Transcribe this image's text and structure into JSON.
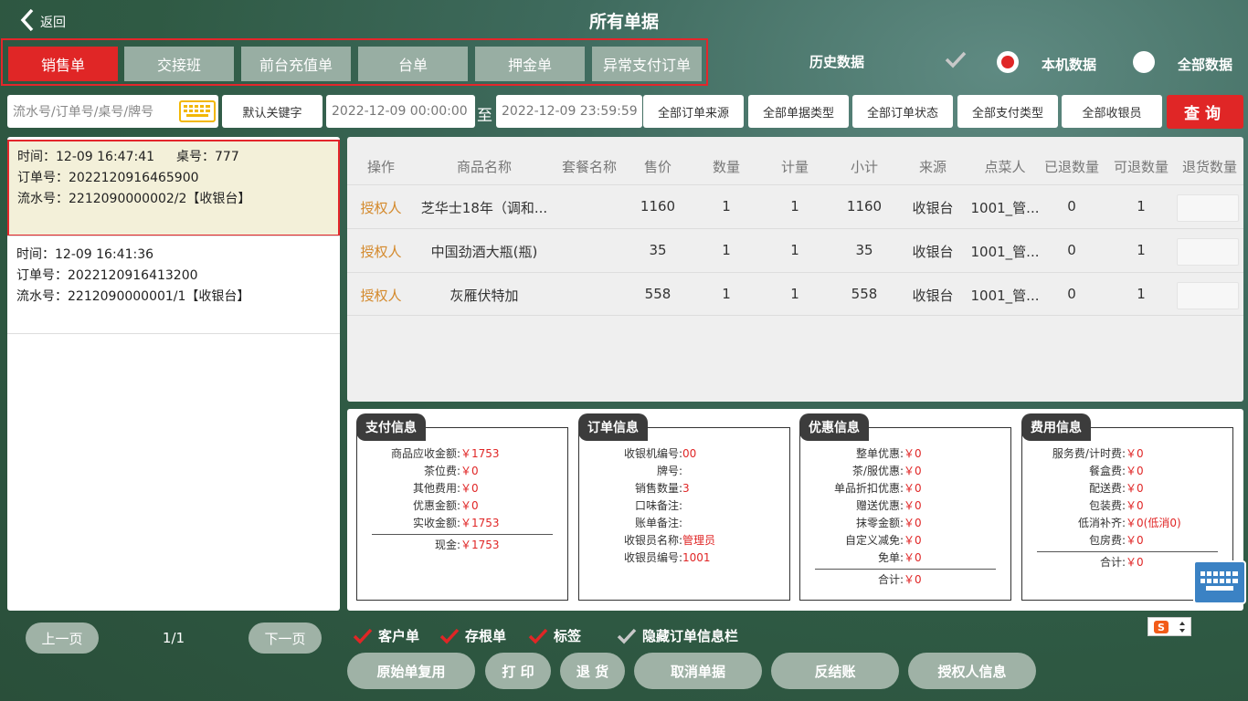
{
  "header": {
    "back_label": "返回",
    "title": "所有单据"
  },
  "tabs": [
    "销售单",
    "交接班",
    "前台充值单",
    "台单",
    "押金单",
    "异常支付订单"
  ],
  "active_tab": 0,
  "data_scope": {
    "history_label": "历史数据",
    "local_label": "本机数据",
    "all_label": "全部数据",
    "selected": "本机数据"
  },
  "filters": {
    "search_placeholder": "流水号/订单号/桌号/牌号",
    "keyword_btn": "默认关键字",
    "date_start": "2022-12-09 00:00:00",
    "to_label": "至",
    "date_end": "2022-12-09 23:59:59",
    "source": "全部订单来源",
    "doc_type": "全部单据类型",
    "status": "全部订单状态",
    "pay_type": "全部支付类型",
    "cashier": "全部收银员",
    "query_btn": "查询"
  },
  "orders": [
    {
      "time": "时间：12-09 16:47:41",
      "table": "桌号：777",
      "order_no": "订单号：2022120916465900",
      "serial": "流水号：2212090000002/2【收银台】"
    },
    {
      "time": "时间：12-09 16:41:36",
      "table": "",
      "order_no": "订单号：2022120916413200",
      "serial": "流水号：2212090000001/1【收银台】"
    }
  ],
  "table": {
    "headers": [
      "操作",
      "商品名称",
      "套餐名称",
      "售价",
      "数量",
      "计量",
      "小计",
      "来源",
      "点菜人",
      "已退数量",
      "可退数量",
      "退货数量"
    ],
    "rows": [
      {
        "op": "授权人",
        "name": "芝华士18年（调和...",
        "combo": "",
        "price": "1160",
        "qty": "1",
        "measure": "1",
        "subtotal": "1160",
        "source": "收银台",
        "by": "1001_管...",
        "returned": "0",
        "returnable": "1"
      },
      {
        "op": "授权人",
        "name": "中国劲酒大瓶(瓶)",
        "combo": "",
        "price": "35",
        "qty": "1",
        "measure": "1",
        "subtotal": "35",
        "source": "收银台",
        "by": "1001_管...",
        "returned": "0",
        "returnable": "1"
      },
      {
        "op": "授权人",
        "name": "灰雁伏特加",
        "combo": "",
        "price": "558",
        "qty": "1",
        "measure": "1",
        "subtotal": "558",
        "source": "收银台",
        "by": "1001_管...",
        "returned": "0",
        "returnable": "1"
      }
    ]
  },
  "pay_info": {
    "title": "支付信息",
    "lines": [
      {
        "label": "商品应收金额:",
        "value": "￥1753"
      },
      {
        "label": "茶位费:",
        "value": "￥0"
      },
      {
        "label": "其他费用:",
        "value": "￥0"
      },
      {
        "label": "优惠金额:",
        "value": "￥0"
      },
      {
        "label": "实收金额:",
        "value": "￥1753"
      }
    ],
    "after": [
      {
        "label": "现金:",
        "value": "￥1753"
      }
    ]
  },
  "order_info": {
    "title": "订单信息",
    "lines": [
      {
        "label": "收银机编号:",
        "value": "00"
      },
      {
        "label": "牌号:",
        "value": ""
      },
      {
        "label": "销售数量:",
        "value": "3"
      },
      {
        "label": "口味备注:",
        "value": ""
      },
      {
        "label": "账单备注:",
        "value": ""
      },
      {
        "label": "收银员名称:",
        "value": "管理员"
      },
      {
        "label": "收银员编号:",
        "value": "1001"
      }
    ]
  },
  "discount_info": {
    "title": "优惠信息",
    "lines": [
      {
        "label": "整单优惠:",
        "value": "￥0"
      },
      {
        "label": "茶/服优惠:",
        "value": "￥0"
      },
      {
        "label": "单品折扣优惠:",
        "value": "￥0"
      },
      {
        "label": "赠送优惠:",
        "value": "￥0"
      },
      {
        "label": "抹零金额:",
        "value": "￥0"
      },
      {
        "label": "自定义减免:",
        "value": "￥0"
      },
      {
        "label": "免单:",
        "value": "￥0"
      }
    ],
    "after": [
      {
        "label": "合计:",
        "value": "￥0"
      }
    ]
  },
  "fee_info": {
    "title": "费用信息",
    "lines": [
      {
        "label": "服务费/计时费:",
        "value": "￥0"
      },
      {
        "label": "餐盒费:",
        "value": "￥0"
      },
      {
        "label": "配送费:",
        "value": "￥0"
      },
      {
        "label": "包装费:",
        "value": "￥0"
      },
      {
        "label": "低消补齐:",
        "value": "￥0(低消0)"
      },
      {
        "label": "包房费:",
        "value": "￥0"
      }
    ],
    "after": [
      {
        "label": "合计:",
        "value": "￥0"
      }
    ]
  },
  "pager": {
    "prev": "上一页",
    "page": "1/1",
    "next": "下一页"
  },
  "checkboxes": [
    {
      "label": "客户单",
      "checked": true
    },
    {
      "label": "存根单",
      "checked": true
    },
    {
      "label": "标签",
      "checked": true
    },
    {
      "label": "隐藏订单信息栏",
      "checked": false
    }
  ],
  "actions": [
    "原始单复用",
    "打 印",
    "退 货",
    "取消单据",
    "反结账",
    "授权人信息"
  ],
  "colors": {
    "accent": "#e02626",
    "operator": "#d4892b",
    "button": "#9fb2a6"
  }
}
